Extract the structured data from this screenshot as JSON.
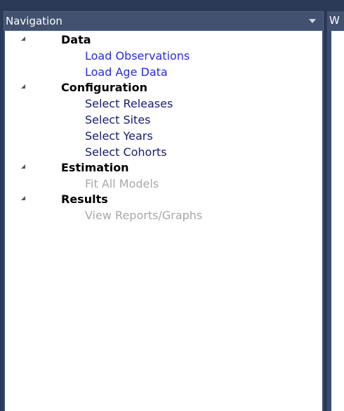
{
  "colors": {
    "frame": "#2b3a57",
    "header": "#42516f",
    "link": "#2a2adf",
    "enabled": "#171c6e",
    "disabled": "#a8a8a8"
  },
  "header": {
    "title": "Navigation",
    "menu_icon": "chevron-down-icon",
    "side_title": "W"
  },
  "tree": {
    "groups": [
      {
        "label": "Data",
        "items": [
          {
            "label": "Load Observations",
            "state": "link"
          },
          {
            "label": "Load Age Data",
            "state": "link"
          }
        ]
      },
      {
        "label": "Configuration",
        "items": [
          {
            "label": "Select Releases",
            "state": "enabled"
          },
          {
            "label": "Select Sites",
            "state": "enabled"
          },
          {
            "label": "Select Years",
            "state": "enabled"
          },
          {
            "label": "Select Cohorts",
            "state": "enabled"
          }
        ]
      },
      {
        "label": "Estimation",
        "items": [
          {
            "label": "Fit All Models",
            "state": "disabled"
          }
        ]
      },
      {
        "label": "Results",
        "items": [
          {
            "label": "View Reports/Graphs",
            "state": "disabled"
          }
        ]
      }
    ]
  }
}
